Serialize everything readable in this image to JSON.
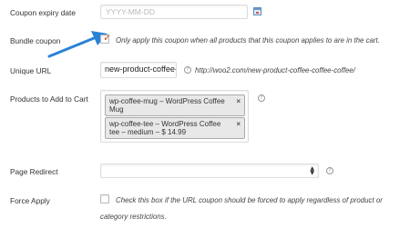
{
  "coupon_expiry": {
    "label": "Coupon expiry date",
    "placeholder": "YYYY-MM-DD",
    "icon": "calendar-icon"
  },
  "bundle_coupon": {
    "label": "Bundle coupon",
    "checked": true,
    "description": "Only apply this coupon when all products that this coupon applies to are in the cart."
  },
  "unique_url": {
    "label": "Unique URL",
    "value": "new-product-coffee-coffee-coffee",
    "full_url": "http://woo2.com/new-product-coffee-coffee-coffee/"
  },
  "products_to_add": {
    "label": "Products to Add to Cart",
    "items": [
      {
        "line1": "wp-coffee-mug – WordPress Coffee",
        "line2": "Mug"
      },
      {
        "line1": "wp-coffee-tee – WordPress Coffee",
        "line2": "tee – medium – $ 14.99"
      }
    ],
    "remove_glyph": "×"
  },
  "page_redirect": {
    "label": "Page Redirect",
    "value": ""
  },
  "force_apply": {
    "label": "Force Apply",
    "checked": false,
    "description_line1": "Check this box if the URL coupon should be forced to apply regardless of product or",
    "description_line2": "category restrictions."
  },
  "colors": {
    "accent_arrow": "#2a82d6",
    "checkmark": "#d54e21",
    "token_bg": "#e8e8e8"
  }
}
